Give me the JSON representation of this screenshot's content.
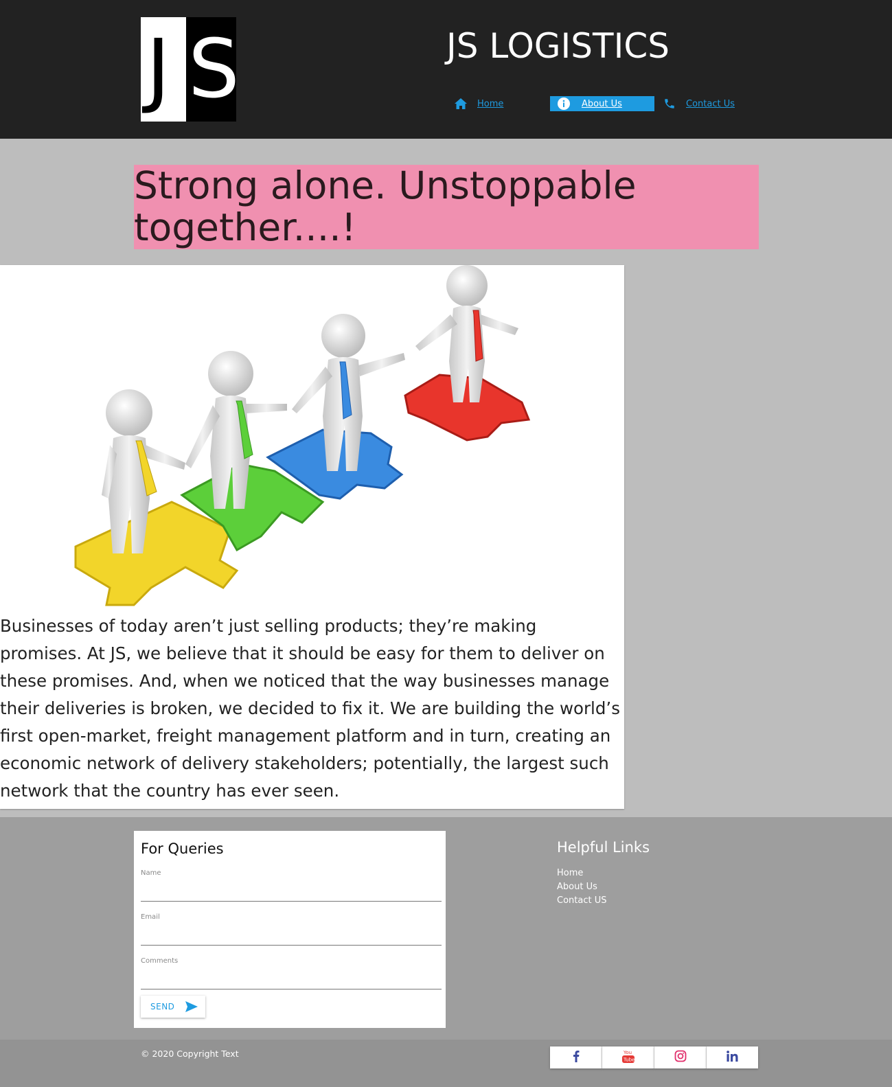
{
  "header": {
    "logo_letters": {
      "left": "J",
      "right": "S"
    },
    "site_title": "JS LOGISTICS",
    "nav": [
      {
        "label": "Home",
        "icon": "home-icon"
      },
      {
        "label": "About Us",
        "icon": "info-icon",
        "active": true
      },
      {
        "label": "Contact Us",
        "icon": "phone-icon"
      }
    ]
  },
  "hero": {
    "headline_line1": "Strong alone. Unstoppable",
    "headline_line2": "together....!",
    "image": "team-puzzle-illustration",
    "body": "Businesses of today aren’t just selling products; they’re making promises. At JS, we believe that it should be easy for them to deliver on these promises. And, when we noticed that the way businesses manage their deliveries is broken, we decided to fix it. We are building the world’s first open-market, freight management platform and in turn, creating an economic network of delivery stakeholders; potentially, the largest such network that the country has ever seen."
  },
  "form": {
    "title": "For Queries",
    "name_label": "Name",
    "name_value": "",
    "email_label": "Email",
    "email_value": "",
    "comments_label": "Comments",
    "comments_value": "",
    "send_label": "SEND"
  },
  "links": {
    "title": "Helpful Links",
    "items": [
      "Home",
      "About Us",
      "Contact US"
    ]
  },
  "footer": {
    "copyright": "© 2020 Copyright Text",
    "social": [
      "facebook-icon",
      "youtube-icon",
      "instagram-icon",
      "linkedin-icon"
    ]
  },
  "colors": {
    "header_bg": "#222222",
    "accent": "#1e9be0",
    "headline_bg": "#f090b0",
    "page_bg": "#bdbdbd",
    "footer_bg": "#9e9e9e"
  }
}
